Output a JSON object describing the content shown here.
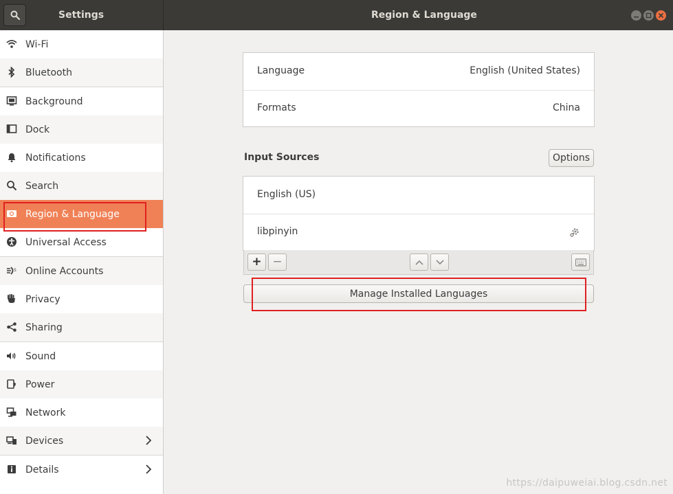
{
  "header": {
    "left_title": "Settings",
    "main_title": "Region & Language",
    "search_icon": "search-icon",
    "window_controls": [
      "minimize-icon",
      "maximize-icon",
      "close-icon"
    ]
  },
  "sidebar": {
    "items": [
      {
        "label": "Wi-Fi",
        "icon": "wifi-icon"
      },
      {
        "label": "Bluetooth",
        "icon": "bluetooth-icon"
      },
      {
        "label": "Background",
        "icon": "background-icon"
      },
      {
        "label": "Dock",
        "icon": "dock-icon"
      },
      {
        "label": "Notifications",
        "icon": "bell-icon"
      },
      {
        "label": "Search",
        "icon": "search-icon"
      },
      {
        "label": "Region & Language",
        "icon": "region-icon",
        "active": true
      },
      {
        "label": "Universal Access",
        "icon": "accessibility-icon"
      },
      {
        "label": "Online Accounts",
        "icon": "online-accounts-icon"
      },
      {
        "label": "Privacy",
        "icon": "hand-icon"
      },
      {
        "label": "Sharing",
        "icon": "share-icon"
      },
      {
        "label": "Sound",
        "icon": "speaker-icon"
      },
      {
        "label": "Power",
        "icon": "power-icon"
      },
      {
        "label": "Network",
        "icon": "network-icon"
      },
      {
        "label": "Devices",
        "icon": "devices-icon"
      },
      {
        "label": "Details",
        "icon": "info-icon"
      }
    ]
  },
  "main": {
    "language_label": "Language",
    "language_value": "English (United States)",
    "formats_label": "Formats",
    "formats_value": "China",
    "input_sources_title": "Input Sources",
    "options_button": "Options",
    "input_sources": [
      "English (US)",
      "libpinyin"
    ],
    "add_label": "+",
    "remove_label": "−",
    "manage_button": "Manage Installed Languages"
  },
  "watermark": "https://daipuweiai.blog.csdn.net",
  "colors": {
    "accent": "#f08156",
    "header_bg": "#3b3a37",
    "highlight_box": "#e02020"
  }
}
